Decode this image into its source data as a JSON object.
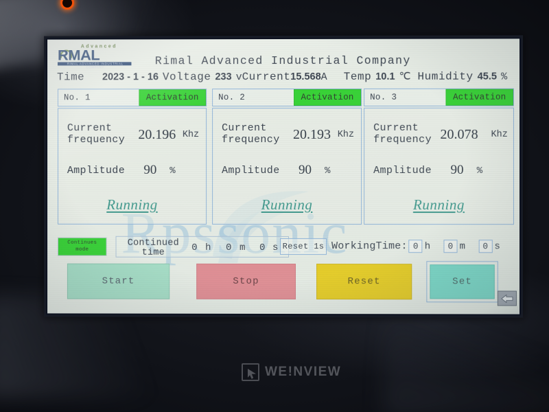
{
  "device": {
    "brand": "WE!NVIEW",
    "brand_icon": "touch-panel-icon",
    "power_led_color": "#f1520a"
  },
  "screen": {
    "logo": {
      "top_text": "Advanced",
      "main_text": "RMAL",
      "bar_text": "RIMAL ADVANCED INDUSTRIAL COMPANY"
    },
    "title": "Rimal Advanced Industrial Company",
    "info_bar": {
      "time_label": "Time",
      "time_value": "2023 - 1 - 16",
      "voltage_label": "Voltage",
      "voltage_value": "233",
      "voltage_unit": "v",
      "current_label": "Current",
      "current_value": "15.568",
      "current_unit": "A",
      "temp_label": "Temp",
      "temp_value": "10.1",
      "temp_unit": "℃",
      "humidity_label": "Humidity",
      "humidity_value": "45.5",
      "humidity_unit": "%"
    },
    "channels": [
      {
        "no_label": "No. 1",
        "activation_label": "Activation",
        "activation_color": "#25cf22",
        "frequency_label": "Current\nfrequency",
        "frequency_label_line1": "Current",
        "frequency_label_line2": "frequency",
        "frequency_value": "20.196",
        "frequency_unit": "Khz",
        "amplitude_label": "Amplitude",
        "amplitude_value": "90",
        "amplitude_unit": "%",
        "status": "Running"
      },
      {
        "no_label": "No. 2",
        "activation_label": "Activation",
        "activation_color": "#25cf22",
        "frequency_label_line1": "Current",
        "frequency_label_line2": "frequency",
        "frequency_value": "20.193",
        "frequency_unit": "Khz",
        "amplitude_label": "Amplitude",
        "amplitude_value": "90",
        "amplitude_unit": "%",
        "status": "Running"
      },
      {
        "no_label": "No. 3",
        "activation_label": "Activation",
        "activation_color": "#25cf22",
        "frequency_label_line1": "Current",
        "frequency_label_line2": "frequency",
        "frequency_value": "20.078",
        "frequency_unit": "Khz",
        "amplitude_label": "Amplitude",
        "amplitude_value": "90",
        "amplitude_unit": "%",
        "status": "Running"
      }
    ],
    "timer_strip": {
      "mode_button_line1": "Continues",
      "mode_button_line2": "mode",
      "mode_button_color": "#25cf22",
      "continued_time_label_line1": "Continued",
      "continued_time_label_line2": "time",
      "continued_hours": "0",
      "hours_unit": "h",
      "continued_minutes": "0",
      "minutes_unit": "m",
      "continued_seconds": "0",
      "seconds_unit": "s",
      "reset_1s_label": "Reset 1s",
      "working_time_label": "WorkingTime:",
      "working_hours": "0",
      "working_hours_unit": "h",
      "working_minutes": "0",
      "working_minutes_unit": "m",
      "working_seconds": "0",
      "working_seconds_unit": "s"
    },
    "actions": {
      "start_label": "Start",
      "start_color": "#9fdcc2",
      "stop_label": "Stop",
      "stop_color": "#e18289",
      "reset_label": "Reset",
      "reset_color": "#e8c90c",
      "set_label": "Set",
      "set_color": "#6fd7c4",
      "back_icon": "back-arrow-icon"
    },
    "watermark": "Rpssonic"
  }
}
